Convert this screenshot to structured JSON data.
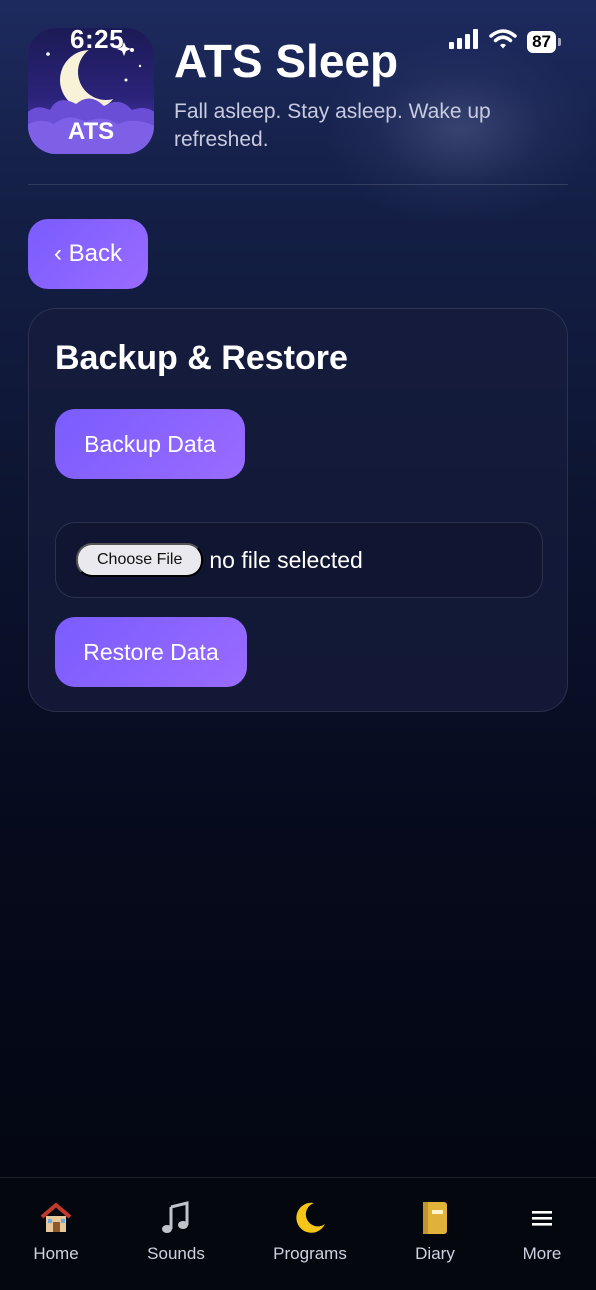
{
  "status_bar": {
    "time": "6:25",
    "battery": "87"
  },
  "header": {
    "app_icon_text": "ATS",
    "title": "ATS Sleep",
    "subtitle": "Fall asleep. Stay asleep. Wake up refreshed."
  },
  "back_button": {
    "label": "‹ Back"
  },
  "card": {
    "title": "Backup & Restore",
    "backup_label": "Backup Data",
    "file_input": {
      "button_label": "Choose File",
      "status": "no file selected"
    },
    "restore_label": "Restore Data"
  },
  "bottom_nav": {
    "items": [
      {
        "label": "Home",
        "icon": "house-icon"
      },
      {
        "label": "Sounds",
        "icon": "music-note-icon"
      },
      {
        "label": "Programs",
        "icon": "crescent-moon-icon"
      },
      {
        "label": "Diary",
        "icon": "notebook-icon"
      },
      {
        "label": "More",
        "icon": "menu-icon"
      }
    ]
  },
  "colors": {
    "accent": "#7a5cff",
    "background_top": "#1d2a5e",
    "background_bottom": "#03050f",
    "card": "#161c3c"
  }
}
